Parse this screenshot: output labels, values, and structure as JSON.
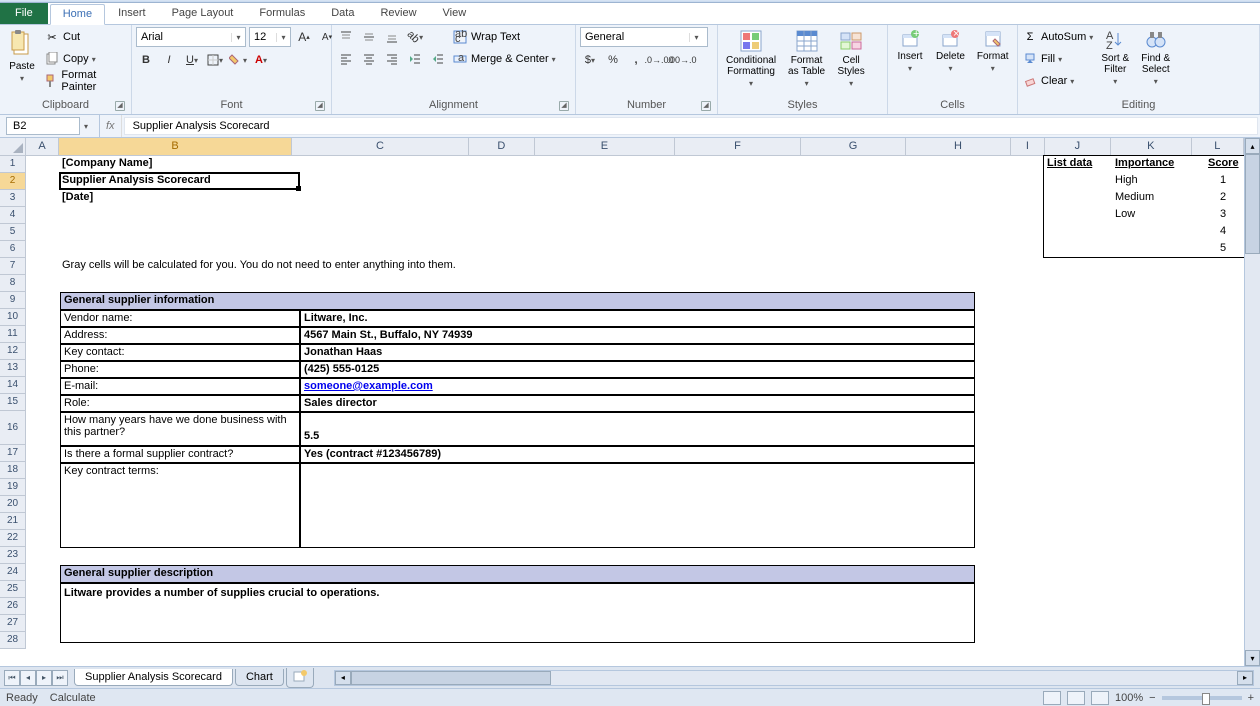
{
  "tabs": {
    "file": "File",
    "home": "Home",
    "insert": "Insert",
    "pageLayout": "Page Layout",
    "formulas": "Formulas",
    "data": "Data",
    "review": "Review",
    "view": "View"
  },
  "ribbon": {
    "clipboard": {
      "paste": "Paste",
      "cut": "Cut",
      "copy": "Copy",
      "formatPainter": "Format Painter",
      "label": "Clipboard"
    },
    "font": {
      "name": "Arial",
      "size": "12",
      "label": "Font"
    },
    "alignment": {
      "wrap": "Wrap Text",
      "merge": "Merge & Center",
      "label": "Alignment"
    },
    "number": {
      "format": "General",
      "label": "Number"
    },
    "styles": {
      "cond": "Conditional\nFormatting",
      "table": "Format\nas Table",
      "cell": "Cell\nStyles",
      "label": "Styles"
    },
    "cells": {
      "insert": "Insert",
      "delete": "Delete",
      "format": "Format",
      "label": "Cells"
    },
    "editing": {
      "autosum": "AutoSum",
      "fill": "Fill",
      "clear": "Clear",
      "sort": "Sort &\nFilter",
      "find": "Find &\nSelect",
      "label": "Editing"
    }
  },
  "formulaBar": {
    "cellRef": "B2",
    "fx": "fx",
    "value": "Supplier Analysis Scorecard"
  },
  "columns": [
    "A",
    "B",
    "C",
    "D",
    "E",
    "F",
    "G",
    "H",
    "I",
    "J",
    "K",
    "L"
  ],
  "content": {
    "b1": "[Company Name]",
    "b2": "Supplier Analysis Scorecard",
    "b3": "[Date]",
    "b7": "Gray cells will be calculated for you. You do not need to enter anything into them.",
    "sec1": "General supplier information",
    "vendorLbl": "Vendor name:",
    "vendor": "Litware, Inc.",
    "addrLbl": "Address:",
    "addr": "4567 Main St., Buffalo, NY 74939",
    "contactLbl": "Key contact:",
    "contact": "Jonathan Haas",
    "phoneLbl": "Phone:",
    "phone": "(425) 555-0125",
    "emailLbl": "E-mail:",
    "email": "someone@example.com",
    "roleLbl": "Role:",
    "role": "Sales director",
    "yearsLbl": "How many years have we done business with this partner?",
    "years": "5.5",
    "formalLbl": "Is there a formal supplier contract?",
    "formal": "Yes (contract #123456789)",
    "termsLbl": "Key contract terms:",
    "sec2": "General supplier description",
    "desc": "Litware provides a number of supplies crucial to operations.",
    "listData": "List data",
    "importance": "Importance",
    "score": "Score",
    "high": "High",
    "medium": "Medium",
    "low": "Low",
    "s1": "1",
    "s2": "2",
    "s3": "3",
    "s4": "4",
    "s5": "5"
  },
  "sheetTabs": {
    "s1": "Supplier Analysis Scorecard",
    "s2": "Chart"
  },
  "status": {
    "ready": "Ready",
    "calc": "Calculate",
    "zoom": "100%"
  }
}
